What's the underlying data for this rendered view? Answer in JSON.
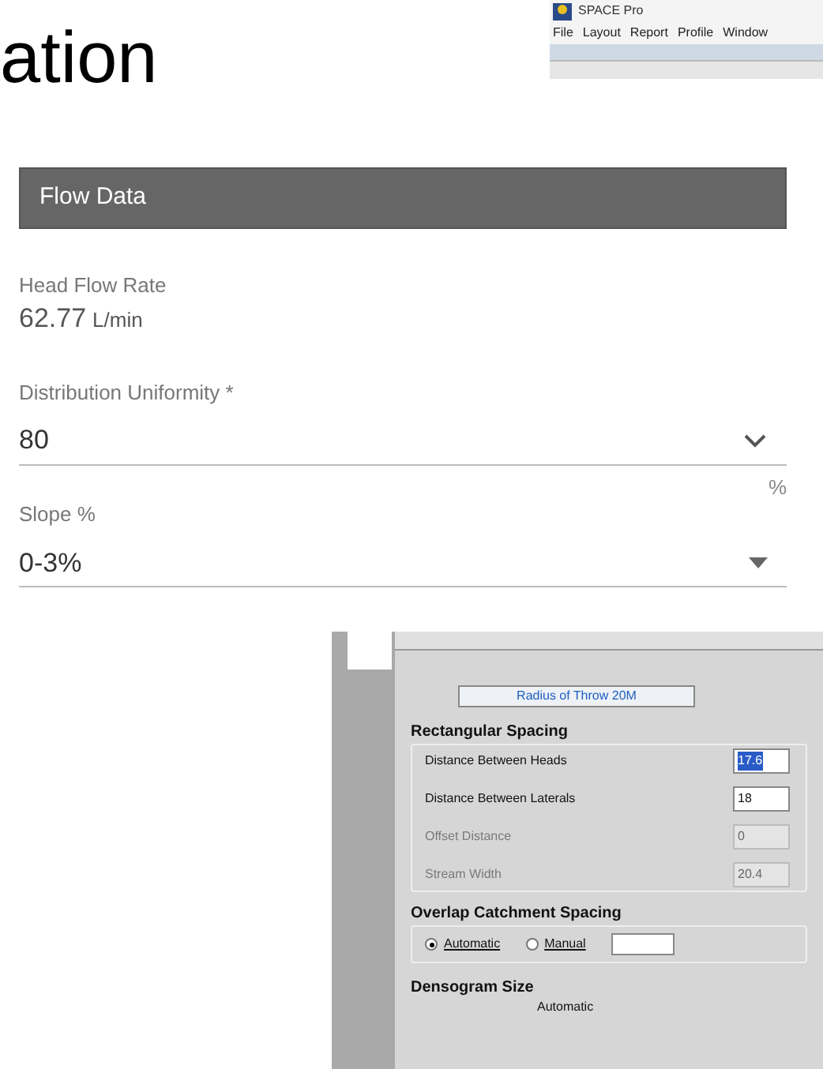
{
  "slide": {
    "title": "ation"
  },
  "space_window": {
    "title": "SPACE Pro",
    "menu": [
      "File",
      "Layout",
      "Report",
      "Profile",
      "Window"
    ]
  },
  "flow_panel": {
    "header": "Flow Data",
    "head_flow": {
      "label": "Head Flow Rate",
      "value": "62.77",
      "unit": "L/min"
    },
    "fields": [
      {
        "kind": "chevron",
        "label": "Distribution Uniformity *",
        "value": "80",
        "suffix": "%"
      },
      {
        "kind": "triangle",
        "label": "Slope %",
        "value": "0-3%"
      }
    ]
  },
  "spacing_dialog": {
    "banner": "Radius of Throw 20M",
    "rect_heading": "Rectangular Spacing",
    "rows": [
      {
        "label": "Distance Between Heads",
        "value": "17.6",
        "selected": true,
        "disabled": false
      },
      {
        "label": "Distance Between Laterals",
        "value": "18",
        "selected": false,
        "disabled": false
      },
      {
        "label": "Offset Distance",
        "value": "0",
        "selected": false,
        "disabled": true
      },
      {
        "label": "Stream Width",
        "value": "20.4",
        "selected": false,
        "disabled": true
      }
    ],
    "overlap_heading": "Overlap Catchment Spacing",
    "radios": [
      {
        "label": "Automatic",
        "selected": true
      },
      {
        "label": "Manual",
        "selected": false
      }
    ],
    "densogram_heading": "Densogram Size",
    "densogram_option": "Automatic"
  }
}
